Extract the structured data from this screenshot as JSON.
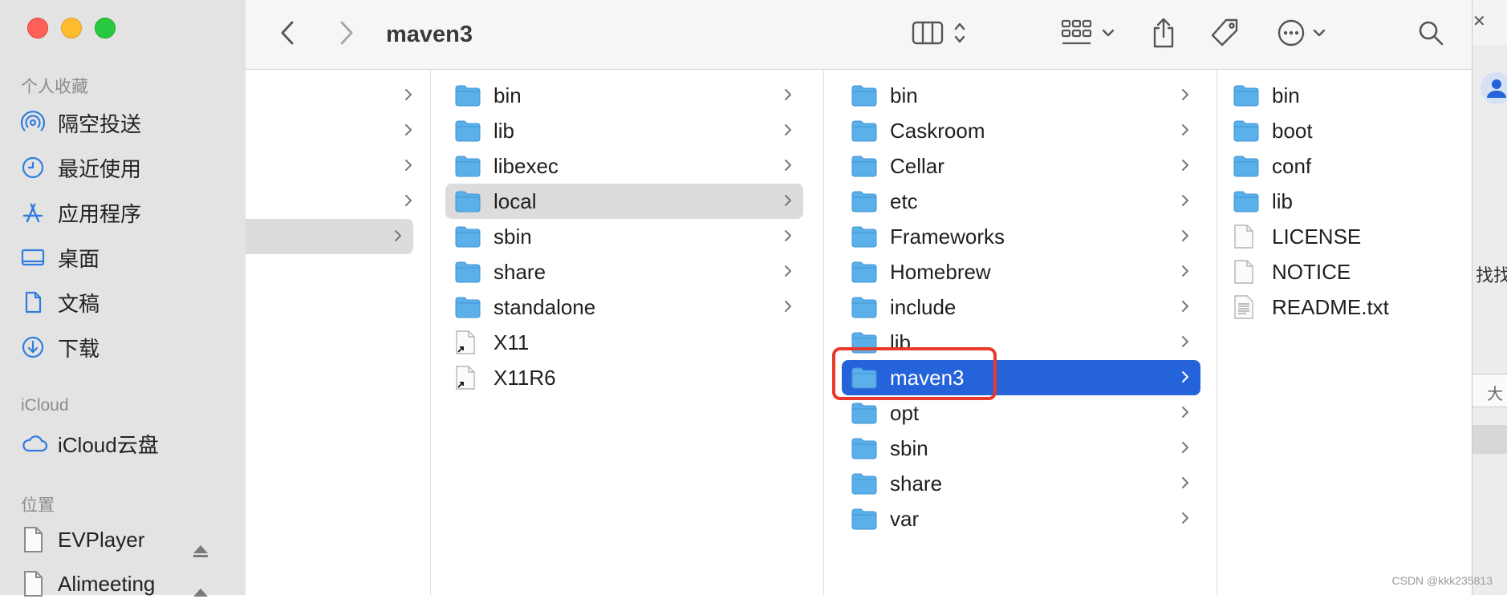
{
  "window": {
    "title": "maven3"
  },
  "sidebar": {
    "favorites_header": "个人收藏",
    "favorites": [
      {
        "label": "隔空投送",
        "icon": "airdrop-icon"
      },
      {
        "label": "最近使用",
        "icon": "clock-icon"
      },
      {
        "label": "应用程序",
        "icon": "applications-icon"
      },
      {
        "label": "桌面",
        "icon": "desktop-icon"
      },
      {
        "label": "文稿",
        "icon": "document-icon"
      },
      {
        "label": "下载",
        "icon": "download-icon"
      }
    ],
    "icloud_header": "iCloud",
    "icloud": [
      {
        "label": "iCloud云盘",
        "icon": "cloud-icon"
      }
    ],
    "locations_header": "位置",
    "locations": [
      {
        "label": "EVPlayer",
        "icon": "disk-icon"
      },
      {
        "label": "Alimeeting",
        "icon": "disk-icon"
      }
    ]
  },
  "columns": {
    "col2": [
      "bin",
      "lib",
      "libexec",
      "local",
      "sbin",
      "share",
      "standalone",
      "X11",
      "X11R6"
    ],
    "col3": [
      "bin",
      "Caskroom",
      "Cellar",
      "etc",
      "Frameworks",
      "Homebrew",
      "include",
      "lib",
      "maven3",
      "opt",
      "sbin",
      "share",
      "var"
    ],
    "col4": [
      "bin",
      "boot",
      "conf",
      "lib",
      "LICENSE",
      "NOTICE",
      "README.txt"
    ]
  },
  "side_window": {
    "text1": "找找",
    "text2": "大"
  },
  "watermark": "CSDN @kkk235813",
  "colors": {
    "folder_blue": "#5bb0ea",
    "selection_blue": "#2463d9",
    "highlight_red": "#e8392a"
  }
}
